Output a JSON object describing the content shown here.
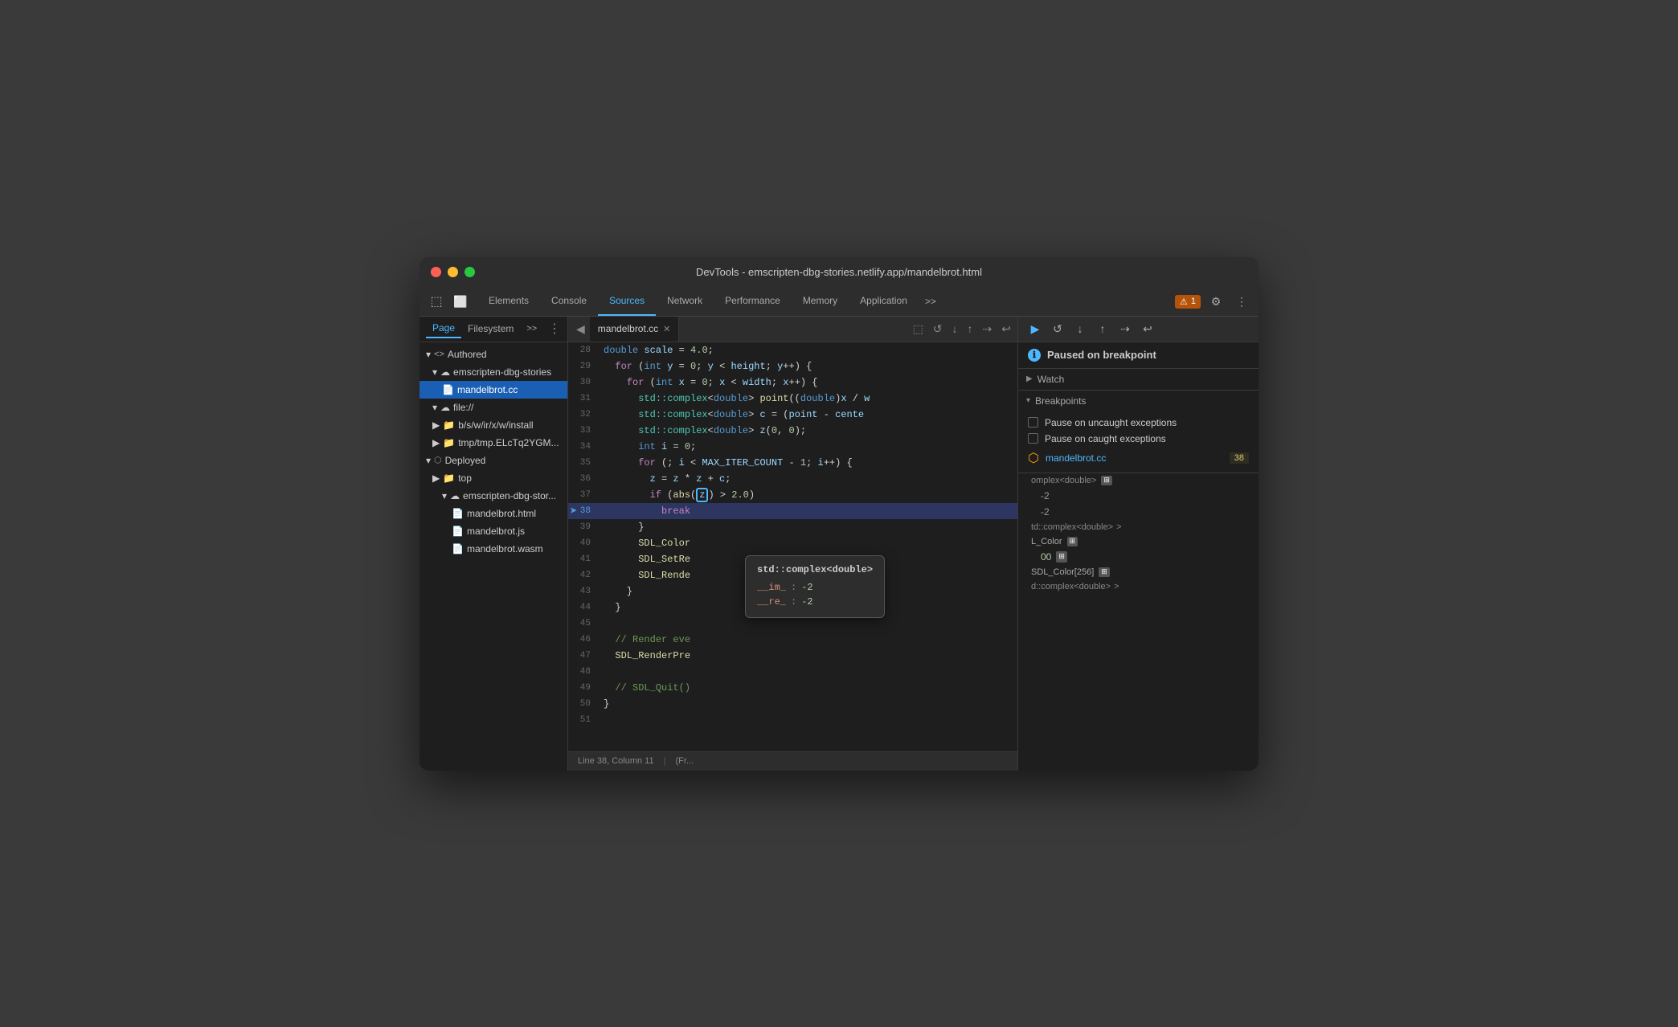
{
  "window": {
    "title": "DevTools - emscripten-dbg-stories.netlify.app/mandelbrot.html",
    "traffic_lights": [
      "red",
      "yellow",
      "green"
    ]
  },
  "tabs": {
    "items": [
      {
        "label": "Elements",
        "active": false
      },
      {
        "label": "Console",
        "active": false
      },
      {
        "label": "Sources",
        "active": true
      },
      {
        "label": "Network",
        "active": false
      },
      {
        "label": "Performance",
        "active": false
      },
      {
        "label": "Memory",
        "active": false
      },
      {
        "label": "Application",
        "active": false
      }
    ],
    "more_label": ">>",
    "warning_badge": "1",
    "gear_label": "⚙",
    "menu_label": "⋮"
  },
  "sidebar": {
    "tabs": [
      {
        "label": "Page",
        "active": true
      },
      {
        "label": "Filesystem",
        "active": false
      }
    ],
    "more_label": ">>",
    "menu_label": "⋮",
    "tree": [
      {
        "level": 0,
        "label": "◀▶  Authored",
        "icon": "",
        "type": "folder"
      },
      {
        "level": 1,
        "label": "☁ emscripten-dbg-stories",
        "icon": "",
        "type": "cloud"
      },
      {
        "level": 2,
        "label": "mandelbrot.cc",
        "icon": "📄",
        "type": "file",
        "selected": true
      },
      {
        "level": 1,
        "label": "☁ file://",
        "icon": "",
        "type": "cloud"
      },
      {
        "level": 1,
        "label": "📁 b/s/w/ir/x/w/install",
        "icon": "",
        "type": "folder"
      },
      {
        "level": 1,
        "label": "📁 tmp/tmp.ELcTq2YGM...",
        "icon": "",
        "type": "folder"
      },
      {
        "level": 0,
        "label": "▼ Deployed",
        "icon": "",
        "type": "folder"
      },
      {
        "level": 1,
        "label": "▶ 📁 top",
        "icon": "",
        "type": "folder"
      },
      {
        "level": 2,
        "label": "▼ ☁ emscripten-dbg-stor...",
        "icon": "",
        "type": "cloud"
      },
      {
        "level": 3,
        "label": "📄 mandelbrot.html",
        "icon": "",
        "type": "file"
      },
      {
        "level": 3,
        "label": "📄 mandelbrot.js",
        "icon": "",
        "type": "file"
      },
      {
        "level": 3,
        "label": "📄 mandelbrot.wasm",
        "icon": "",
        "type": "file"
      }
    ]
  },
  "file_tab": {
    "name": "mandelbrot.cc",
    "close_label": "✕"
  },
  "code": {
    "lines": [
      {
        "num": 28,
        "content": "  double scale = 4.0;"
      },
      {
        "num": 29,
        "content": "  for (int y = 0; y < height; y++) {"
      },
      {
        "num": 30,
        "content": "    for (int x = 0; x < width; x++) {"
      },
      {
        "num": 31,
        "content": "      std::complex<double> point((double)x / w"
      },
      {
        "num": 32,
        "content": "      std::complex<double> c = (point - cente"
      },
      {
        "num": 33,
        "content": "      std::complex<double> z(0, 0);"
      },
      {
        "num": 34,
        "content": "      int i = 0;"
      },
      {
        "num": 35,
        "content": "      for (; i < MAX_ITER_COUNT - 1; i++) {"
      },
      {
        "num": 36,
        "content": "        z = z * z + c;"
      },
      {
        "num": 37,
        "content": "        if (abs(z) > 2.0)"
      },
      {
        "num": 38,
        "content": "          break",
        "breakpoint": true,
        "current": true
      },
      {
        "num": 39,
        "content": "      }"
      },
      {
        "num": 40,
        "content": "      SDL_Color"
      },
      {
        "num": 41,
        "content": "      SDL_SetRe"
      },
      {
        "num": 42,
        "content": "      SDL_Rende"
      },
      {
        "num": 43,
        "content": "    }"
      },
      {
        "num": 44,
        "content": "  }"
      },
      {
        "num": 45,
        "content": ""
      },
      {
        "num": 46,
        "content": "  // Render eve"
      },
      {
        "num": 47,
        "content": "  SDL_RenderPre"
      },
      {
        "num": 48,
        "content": ""
      },
      {
        "num": 49,
        "content": "  // SDL_Quit()"
      },
      {
        "num": 50,
        "content": "}"
      },
      {
        "num": 51,
        "content": ""
      }
    ]
  },
  "tooltip": {
    "type": "std::complex<double>",
    "fields": [
      {
        "key": "__im_",
        "sep": ":",
        "val": "-2"
      },
      {
        "key": "__re_",
        "sep": ":",
        "val": "-2"
      }
    ]
  },
  "status_bar": {
    "line_col": "Line 38, Column 11",
    "frame_info": "(Fr..."
  },
  "debug_toolbar": {
    "buttons": [
      "▶",
      "↺",
      "↓",
      "↑",
      "⇢",
      "↩"
    ]
  },
  "right_panel": {
    "paused_message": "Paused on breakpoint",
    "watch_label": "Watch",
    "breakpoints_label": "Breakpoints",
    "pause_uncaught": "Pause on uncaught exceptions",
    "pause_caught": "Pause on caught exceptions",
    "breakpoint_file": "mandelbrot.cc",
    "breakpoint_line": "38",
    "scope_items": [
      {
        "type": "complex<double>",
        "suffix": "⊞"
      },
      {
        "key": "",
        "val": "-2",
        "prefix": ""
      },
      {
        "key": "",
        "val": "-2",
        "prefix": ""
      },
      {
        "type": "td::complex<double>",
        "suffix": ">"
      },
      {
        "key": "L_Color",
        "val": "",
        "suffix": "⊞"
      },
      {
        "key": "",
        "val": "00",
        "suffix": "⊞"
      },
      {
        "key": "SDL_Color[256]",
        "val": "",
        "suffix": "⊞"
      },
      {
        "key": "d::complex<double>",
        "val": ">"
      }
    ]
  }
}
